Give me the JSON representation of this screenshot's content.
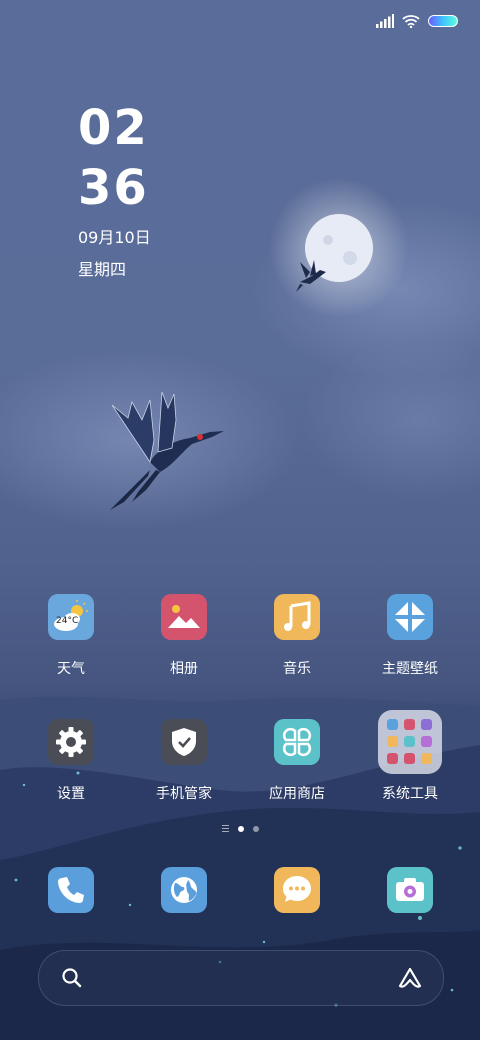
{
  "status_bar": {
    "signal_icon": "signal-icon",
    "wifi_icon": "wifi-icon",
    "battery_icon": "battery-icon"
  },
  "clock": {
    "hour": "02",
    "minute": "36",
    "date": "09月10日",
    "weekday": "星期四"
  },
  "apps": [
    {
      "label": "天气",
      "icon": "weather-icon",
      "color": "#6aa7dc",
      "temp": "24°C"
    },
    {
      "label": "相册",
      "icon": "gallery-icon",
      "color": "#d4546d"
    },
    {
      "label": "音乐",
      "icon": "music-icon",
      "color": "#f0b85a"
    },
    {
      "label": "主题壁纸",
      "icon": "themes-icon",
      "color": "#5aa2dd"
    },
    {
      "label": "设置",
      "icon": "settings-icon",
      "color": "#4a4d55"
    },
    {
      "label": "手机管家",
      "icon": "security-icon",
      "color": "#4a4d55"
    },
    {
      "label": "应用商店",
      "icon": "app-store-icon",
      "color": "#5cc2c9"
    },
    {
      "label": "系统工具",
      "icon": "folder-icon",
      "color": "#e8ebf2"
    }
  ],
  "dock": [
    {
      "icon": "phone-icon",
      "color": "#5a9fdb"
    },
    {
      "icon": "browser-icon",
      "color": "#5a9fdb"
    },
    {
      "icon": "messages-icon",
      "color": "#f0b85a"
    },
    {
      "icon": "camera-icon",
      "color": "#5cc2c9"
    }
  ],
  "pager": {
    "pages": 2,
    "current": 1
  },
  "search_bar": {
    "search_icon": "search-icon",
    "assistant_icon": "assistant-icon"
  }
}
